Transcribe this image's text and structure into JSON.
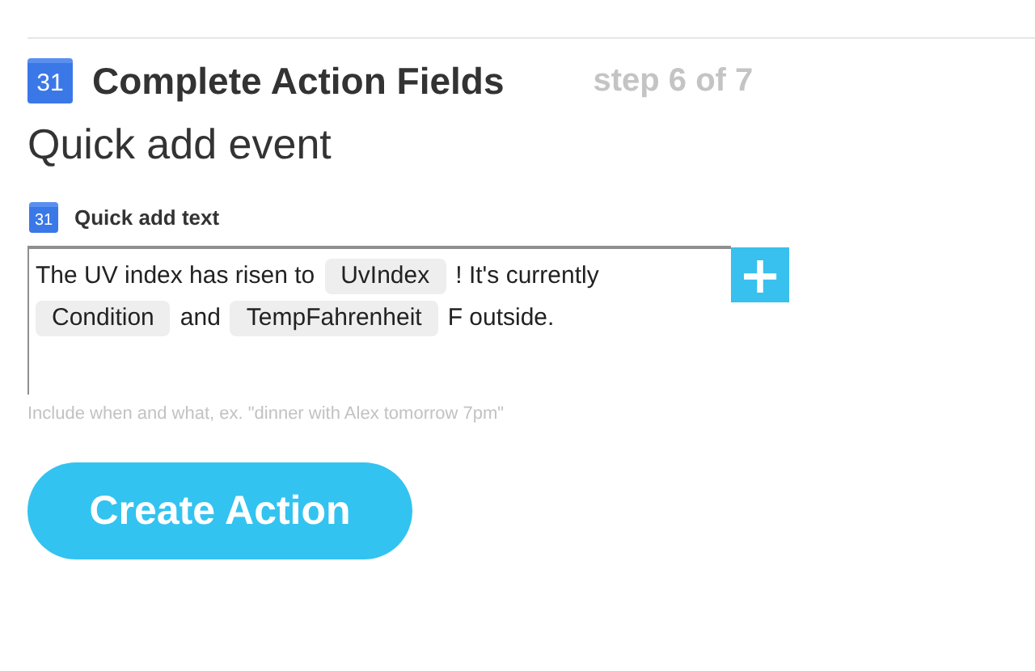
{
  "header": {
    "icon_text": "31",
    "title": "Complete Action Fields",
    "step": "step 6 of 7"
  },
  "subtitle": "Quick add event",
  "field": {
    "icon_text": "31",
    "label": "Quick add text",
    "parts": [
      {
        "kind": "text",
        "text": "The UV index has risen to"
      },
      {
        "kind": "ingredient",
        "text": "UvIndex"
      },
      {
        "kind": "text",
        "text": "! It's currently"
      },
      {
        "kind": "ingredient",
        "text": "Condition"
      },
      {
        "kind": "text",
        "text": "and"
      },
      {
        "kind": "ingredient",
        "text": "TempFahrenheit"
      },
      {
        "kind": "text",
        "text": "F outside."
      }
    ],
    "add_button": "+",
    "hint": "Include when and what, ex. \"dinner with Alex tomorrow 7pm\""
  },
  "button": "Create Action"
}
